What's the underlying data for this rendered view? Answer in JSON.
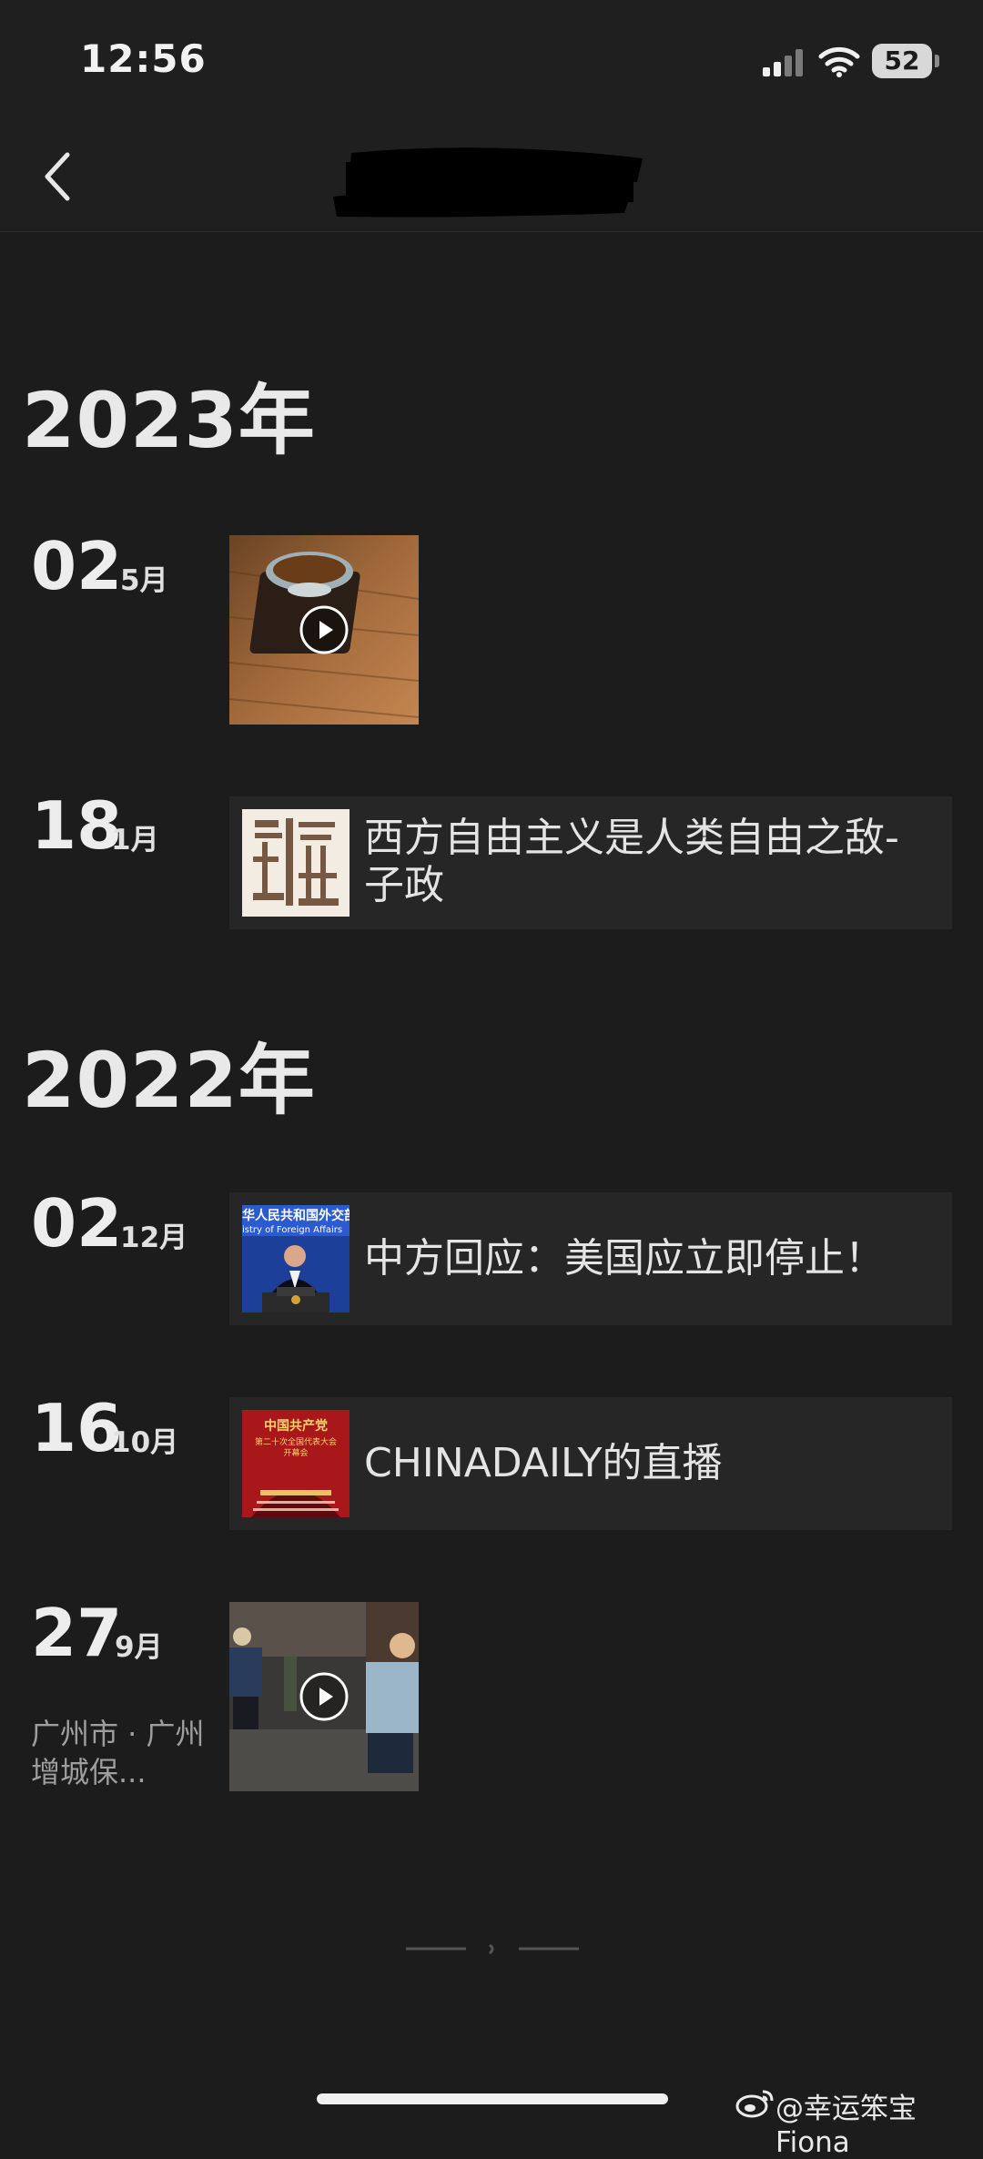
{
  "status_bar": {
    "time": "12:56",
    "battery": "52"
  },
  "nav": {
    "back_icon": "chevron-left-icon"
  },
  "years": [
    {
      "year": "2023年"
    },
    {
      "year": "2022年"
    }
  ],
  "posts": [
    {
      "day": "02",
      "month": "5月",
      "type": "video"
    },
    {
      "day": "18",
      "month": "1月",
      "type": "article",
      "title": "西方自由主义是人类自由之敌-子政"
    },
    {
      "day": "02",
      "month": "12月",
      "type": "article",
      "title": "中方回应：美国应立即停止！"
    },
    {
      "day": "16",
      "month": "10月",
      "type": "article",
      "title": "CHINADAILY的直播"
    },
    {
      "day": "27",
      "month": "9月",
      "type": "video",
      "location": "广州市 · 广州增城保..."
    }
  ],
  "thumbnail_texts": {
    "press_banner": "华人民共和国外交部",
    "press_banner_en": "istry of Foreign Affairs",
    "cpc_line1": "中国共产党",
    "cpc_line2": "第二十次全国代表大会",
    "cpc_line3": "开幕会"
  },
  "watermark": "@幸运笨宝Fiona",
  "colors": {
    "background": "#1c1c1c",
    "card": "#262626",
    "text": "#e6e6e6",
    "muted": "#9e9e9e"
  }
}
